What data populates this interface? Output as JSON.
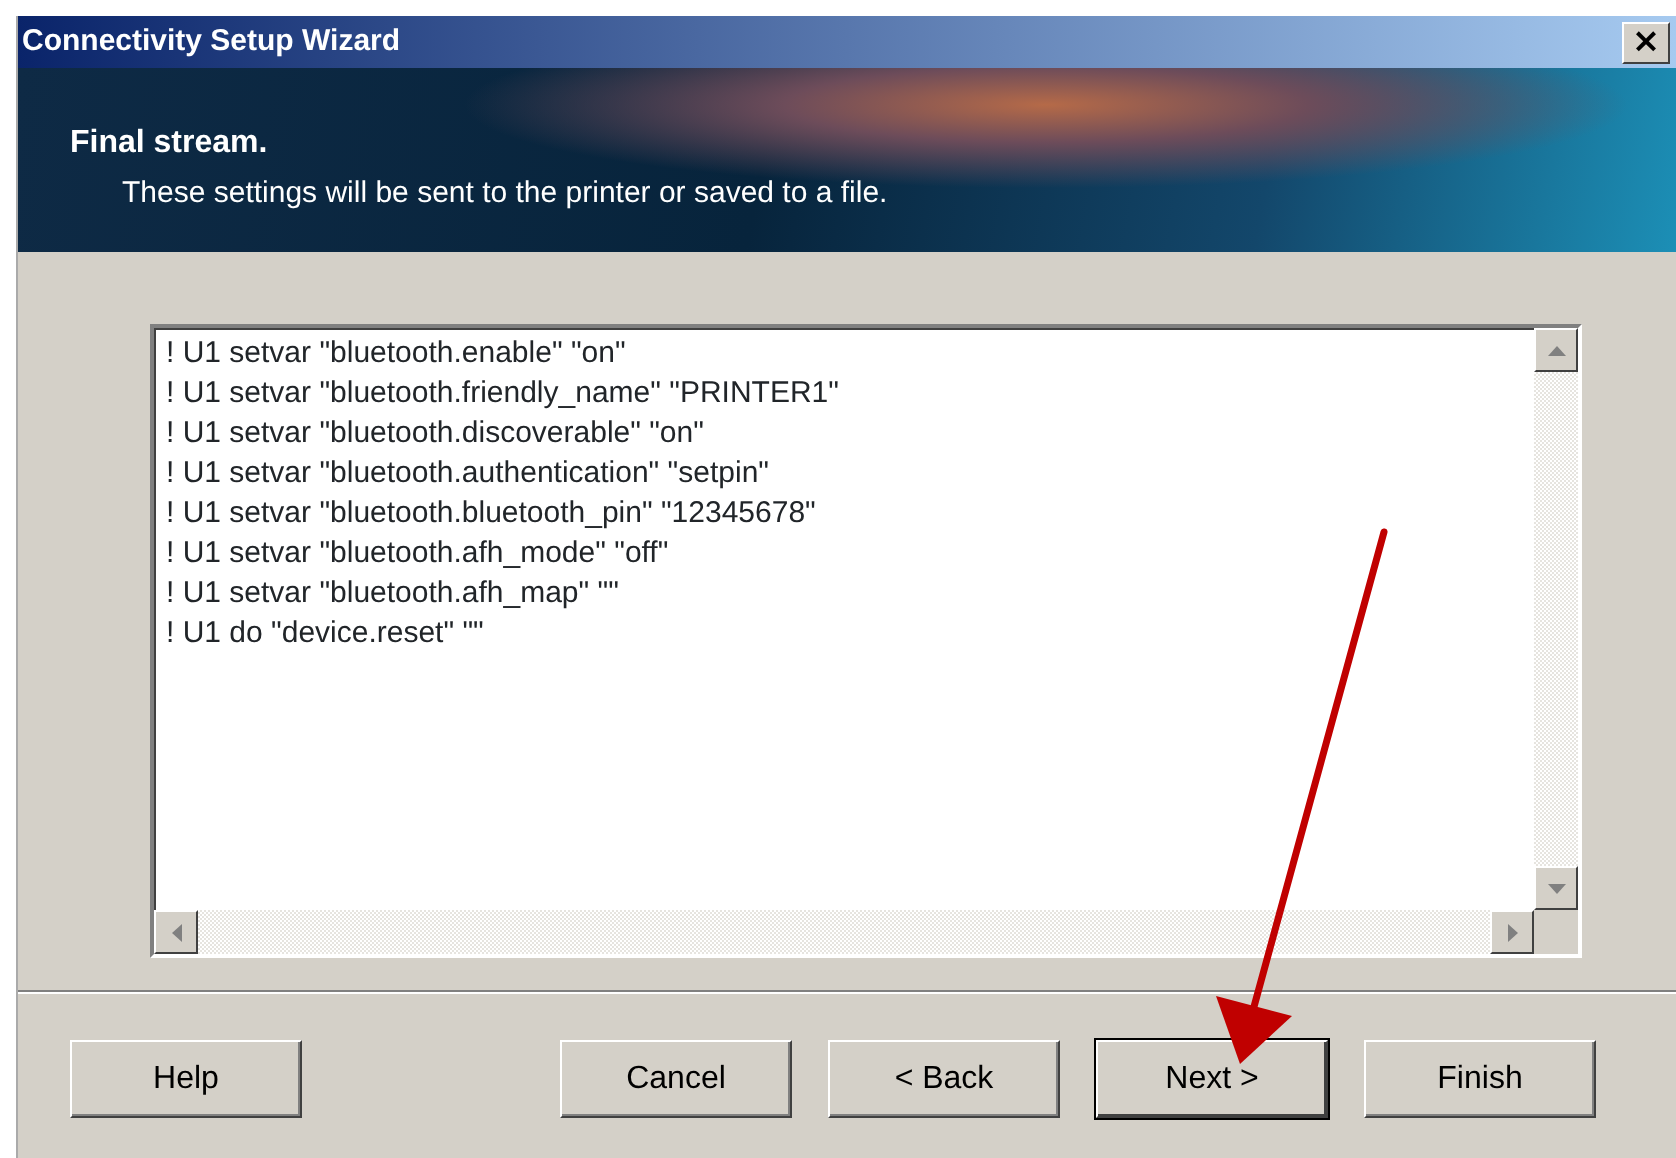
{
  "window": {
    "title": "Connectivity Setup Wizard",
    "close": "×"
  },
  "header": {
    "title": "Final stream.",
    "subtitle": "These settings will be sent to the printer or saved to a file."
  },
  "stream_lines": [
    "! U1 setvar \"bluetooth.enable\" \"on\"",
    "! U1 setvar \"bluetooth.friendly_name\" \"PRINTER1\"",
    "! U1 setvar \"bluetooth.discoverable\" \"on\"",
    "! U1 setvar \"bluetooth.authentication\" \"setpin\"",
    "! U1 setvar \"bluetooth.bluetooth_pin\" \"12345678\"",
    "! U1 setvar \"bluetooth.afh_mode\" \"off\"",
    "! U1 setvar \"bluetooth.afh_map\" \"\"",
    "! U1 do \"device.reset\" \"\""
  ],
  "left_buttons": [
    {
      "label": "Help",
      "default": false
    }
  ],
  "right_buttons": [
    {
      "label": "Cancel",
      "default": false
    },
    {
      "label": "< Back",
      "default": false
    },
    {
      "label": "Next >",
      "default": true
    },
    {
      "label": "Finish",
      "default": false
    }
  ],
  "annotation": {
    "kind": "arrow"
  }
}
